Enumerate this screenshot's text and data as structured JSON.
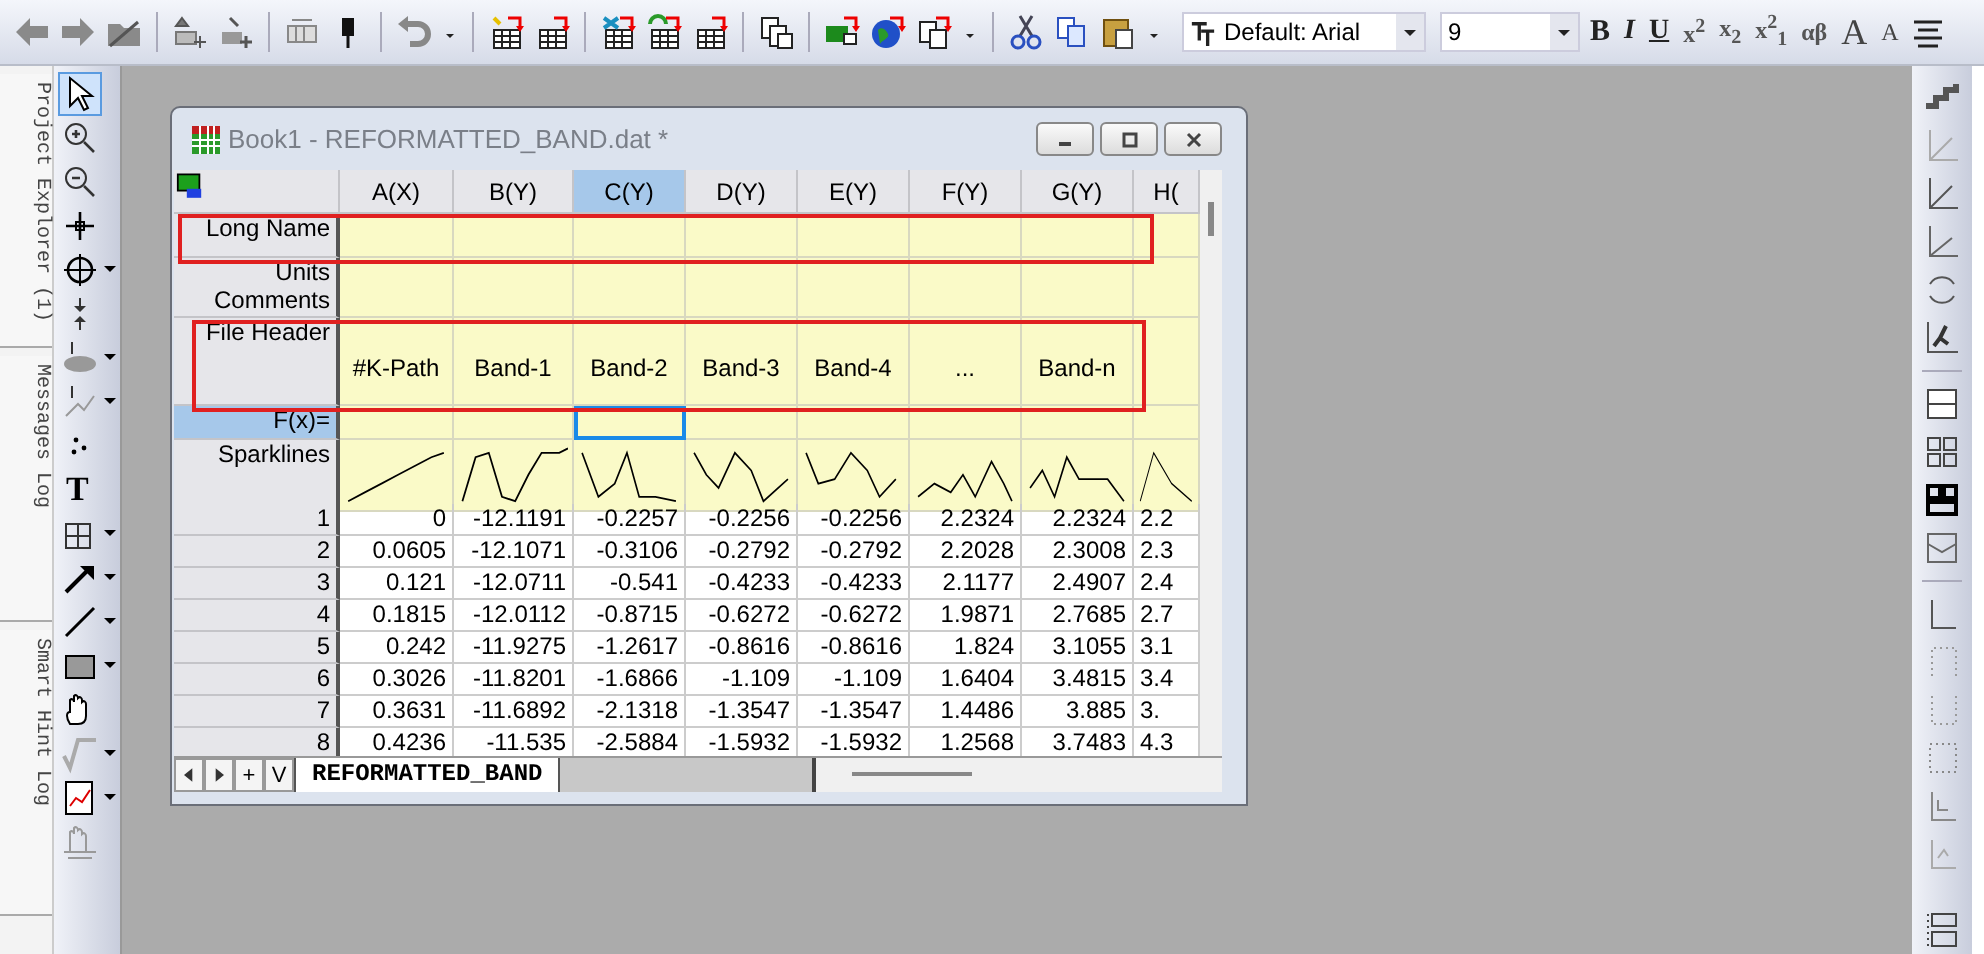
{
  "toolbar": {
    "font": "Default: Arial",
    "font_size": "9",
    "format": [
      "B",
      "I",
      "U",
      "x$^{2}$",
      "x$_{2}$",
      "x$^{2}$$_{1}$",
      "αβ",
      "A",
      "A"
    ]
  },
  "side_panel": {
    "tabs": [
      "Project Explorer (1)",
      "Messages Log",
      "Smart Hint Log"
    ]
  },
  "tools": {
    "text_tool": "T"
  },
  "workbook": {
    "title": "Book1 - REFORMATTED_BAND.dat *",
    "columns": [
      {
        "name": "A(X)",
        "selected": false
      },
      {
        "name": "B(Y)",
        "selected": false
      },
      {
        "name": "C(Y)",
        "selected": true
      },
      {
        "name": "D(Y)",
        "selected": false
      },
      {
        "name": "E(Y)",
        "selected": false
      },
      {
        "name": "F(Y)",
        "selected": false
      },
      {
        "name": "G(Y)",
        "selected": false
      },
      {
        "name": "H(",
        "selected": false
      }
    ],
    "label_rows": [
      {
        "label": "Long Name",
        "kind": "text",
        "selected": false
      },
      {
        "label": "Units",
        "kind": "text",
        "selected": false
      },
      {
        "label": "Comments",
        "kind": "text",
        "selected": false
      },
      {
        "label": "File Header",
        "kind": "file_header",
        "selected": false
      },
      {
        "label": "F(x)=",
        "kind": "formula",
        "selected": true
      },
      {
        "label": "Sparklines",
        "kind": "sparklines",
        "selected": false
      }
    ],
    "file_header": [
      "#K-Path",
      "Band-1",
      "Band-2",
      "Band-3",
      "Band-4",
      "...",
      "Band-n"
    ],
    "rows": [
      {
        "num": "1",
        "values": [
          "0",
          "-12.1191",
          "-0.2257",
          "-0.2256",
          "-0.2256",
          "2.2324",
          "2.2324",
          "2.2"
        ]
      },
      {
        "num": "2",
        "values": [
          "0.0605",
          "-12.1071",
          "-0.3106",
          "-0.2792",
          "-0.2792",
          "2.2028",
          "2.3008",
          "2.3"
        ]
      },
      {
        "num": "3",
        "values": [
          "0.121",
          "-12.0711",
          "-0.541",
          "-0.4233",
          "-0.4233",
          "2.1177",
          "2.4907",
          "2.4"
        ]
      },
      {
        "num": "4",
        "values": [
          "0.1815",
          "-12.0112",
          "-0.8715",
          "-0.6272",
          "-0.6272",
          "1.9871",
          "2.7685",
          "2.7"
        ]
      },
      {
        "num": "5",
        "values": [
          "0.242",
          "-11.9275",
          "-1.2617",
          "-0.8616",
          "-0.8616",
          "1.824",
          "3.1055",
          "3.1"
        ]
      },
      {
        "num": "6",
        "values": [
          "0.3026",
          "-11.8201",
          "-1.6866",
          "-1.109",
          "-1.109",
          "1.6404",
          "3.4815",
          "3.4"
        ]
      },
      {
        "num": "7",
        "values": [
          "0.3631",
          "-11.6892",
          "-2.1318",
          "-1.3547",
          "-1.3547",
          "1.4486",
          "3.885",
          "3."
        ]
      },
      {
        "num": "8",
        "values": [
          "0.4236",
          "-11.535",
          "-2.5884",
          "-1.5932",
          "-1.5932",
          "1.2568",
          "3.7483",
          "4.3"
        ]
      }
    ],
    "sheet_tab": "REFORMATTED_BAND",
    "sheet_buttons": [
      "+",
      "V"
    ]
  }
}
